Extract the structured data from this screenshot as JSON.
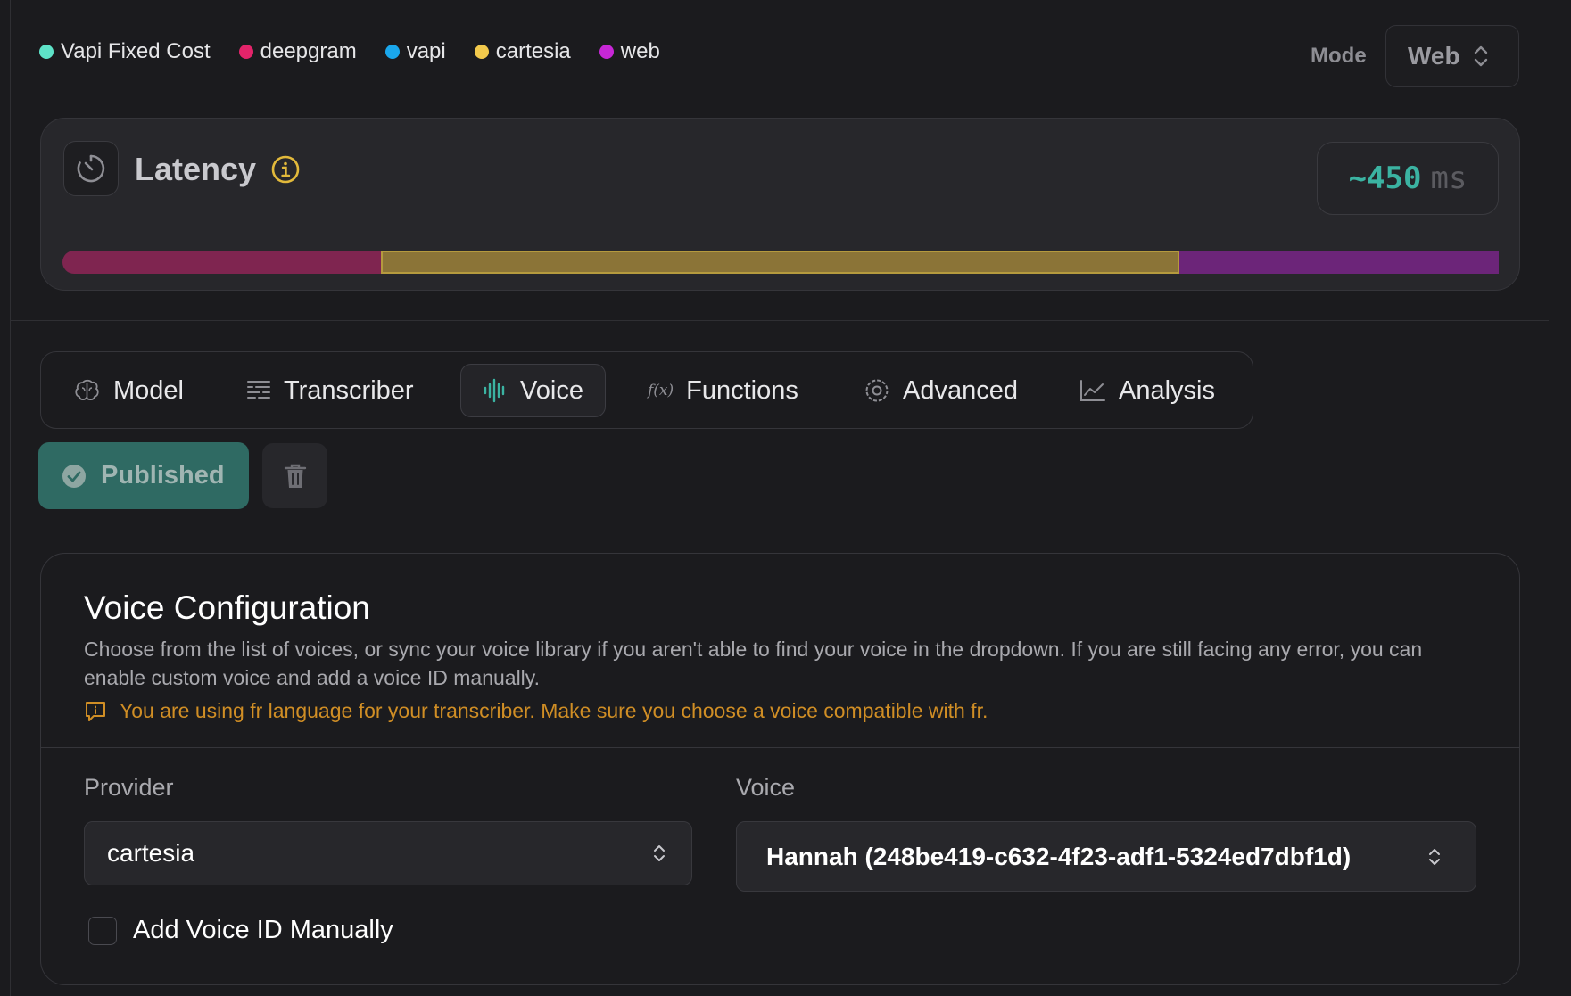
{
  "legend": {
    "items": [
      {
        "label": "Vapi Fixed Cost",
        "color": "#5ee3c8"
      },
      {
        "label": "deepgram",
        "color": "#e3246a"
      },
      {
        "label": "vapi",
        "color": "#1aa7ec"
      },
      {
        "label": "cartesia",
        "color": "#f2c94c"
      },
      {
        "label": "web",
        "color": "#c727d6"
      }
    ]
  },
  "mode": {
    "label": "Mode",
    "value": "Web"
  },
  "latency": {
    "title": "Latency",
    "value": "~450",
    "unit": "ms",
    "segments": [
      {
        "provider": "deepgram",
        "fraction": 0.222,
        "color": "#7f2550"
      },
      {
        "provider": "cartesia",
        "fraction": 0.556,
        "color": "#8b7437"
      },
      {
        "provider": "web",
        "fraction": 0.222,
        "color": "#6c2579"
      }
    ]
  },
  "tabs": [
    {
      "label": "Model",
      "icon": "brain-icon"
    },
    {
      "label": "Transcriber",
      "icon": "text-lines-icon"
    },
    {
      "label": "Voice",
      "icon": "audio-waveform-icon",
      "active": true
    },
    {
      "label": "Functions",
      "icon": "function-icon"
    },
    {
      "label": "Advanced",
      "icon": "gear-icon"
    },
    {
      "label": "Analysis",
      "icon": "line-chart-icon"
    }
  ],
  "actions": {
    "published_label": "Published"
  },
  "voice_config": {
    "title": "Voice Configuration",
    "description": "Choose from the list of voices, or sync your voice library if you aren't able to find your voice in the dropdown. If you are still facing any error, you can enable custom voice and add a voice ID manually.",
    "warning": "You are using fr language for your transcriber. Make sure you choose a voice compatible with fr.",
    "provider_label": "Provider",
    "provider_value": "cartesia",
    "voice_label": "Voice",
    "voice_value": "Hannah (248be419-c632-4f23-adf1-5324ed7dbf1d)",
    "manual_label": "Add Voice ID Manually",
    "manual_checked": false
  }
}
